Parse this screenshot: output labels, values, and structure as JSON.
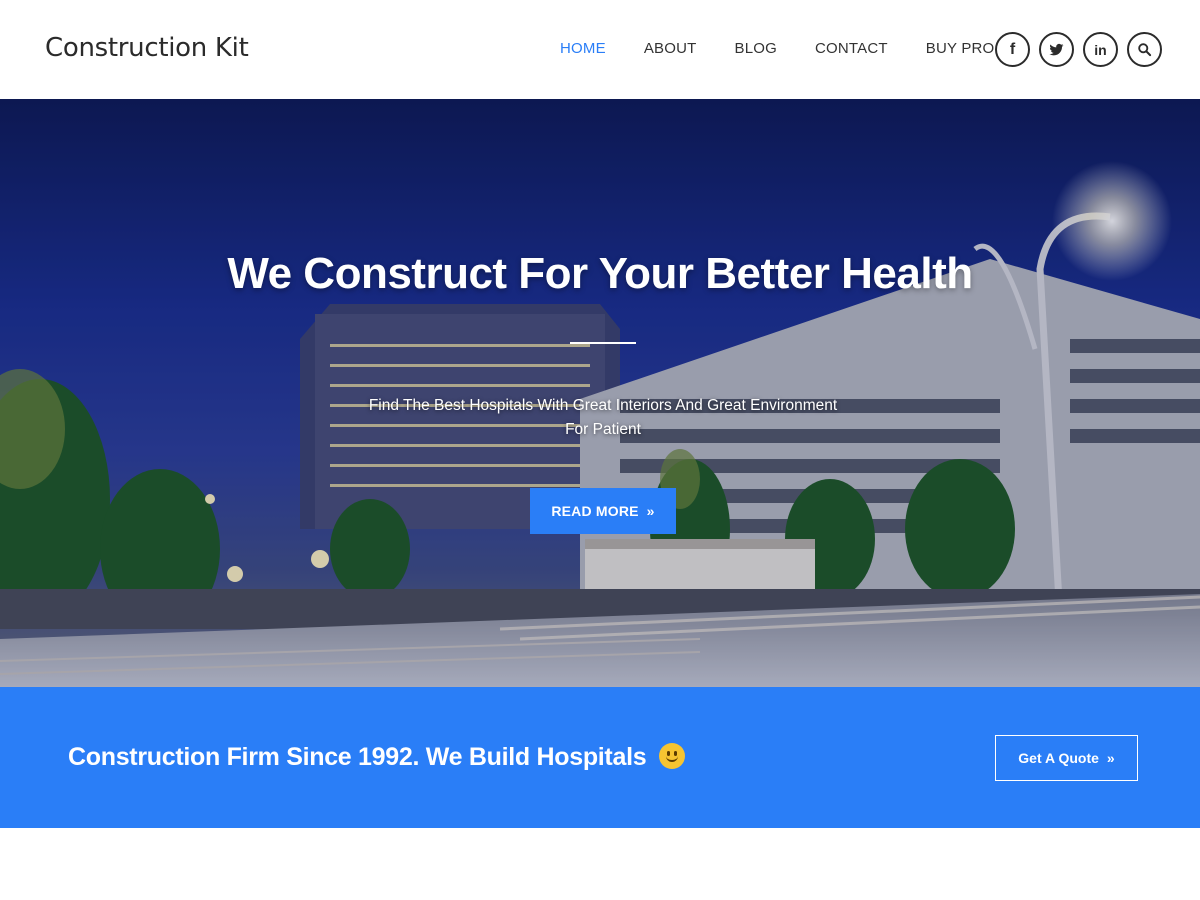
{
  "header": {
    "site_title": "Construction Kit",
    "nav": [
      {
        "label": "HOME",
        "active": true
      },
      {
        "label": "ABOUT",
        "active": false
      },
      {
        "label": "BLOG",
        "active": false
      },
      {
        "label": "CONTACT",
        "active": false
      },
      {
        "label": "BUY PRO",
        "active": false
      }
    ],
    "social": [
      {
        "icon": "facebook-icon",
        "glyph": "f"
      },
      {
        "icon": "twitter-icon",
        "glyph": ""
      },
      {
        "icon": "linkedin-icon",
        "glyph": "in"
      },
      {
        "icon": "search-icon",
        "glyph": ""
      }
    ]
  },
  "hero": {
    "title": "We Construct For Your Better Health",
    "subtitle": "Find The Best Hospitals With Great Interiors And Great Environment For Patient",
    "button_label": "READ MORE",
    "button_icon": "double-chevron-right-icon"
  },
  "cta": {
    "text": "Construction Firm Since 1992. We Build Hospitals",
    "emoji_icon": "smiley-icon",
    "button_label": "Get A Quote",
    "button_icon": "double-chevron-right-icon"
  },
  "colors": {
    "accent": "#2a7ef7",
    "text_dark": "#2b2b2b",
    "white": "#ffffff"
  }
}
